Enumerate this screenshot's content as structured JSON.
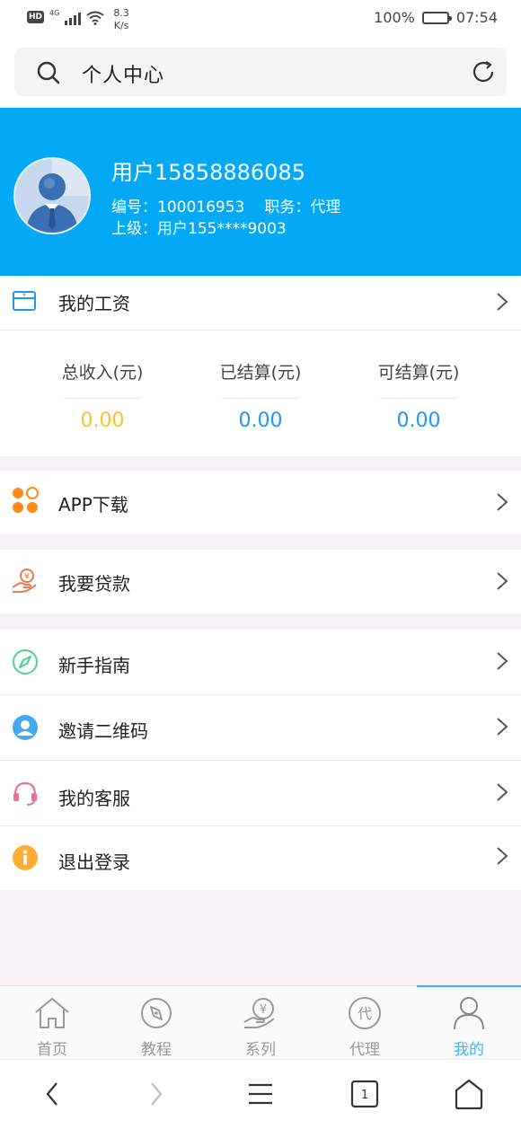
{
  "status_bar": {
    "hd": "HD",
    "network": "4G",
    "speed_value": "8.3",
    "speed_unit": "K/s",
    "battery": "100%",
    "time": "07:54"
  },
  "header": {
    "title": "个人中心",
    "search_icon": "search-icon",
    "refresh_icon": "refresh-icon"
  },
  "profile": {
    "name": "用户15858886085",
    "id_label": "编号：",
    "id_value": "100016953",
    "role_label": "职务：",
    "role_value": "代理",
    "parent_label": "上级：",
    "parent_value": "用户155****9003",
    "banner_color": "#03a9f4"
  },
  "salary": {
    "label": "我的工资",
    "stats": [
      {
        "label": "总收入(元)",
        "value": "0.00",
        "color": "#f7c12f"
      },
      {
        "label": "已结算(元)",
        "value": "0.00",
        "color": "#2196f3"
      },
      {
        "label": "可结算(元)",
        "value": "0.00",
        "color": "#2196f3"
      }
    ]
  },
  "menu": {
    "app_download": "APP下载",
    "loan": "我要贷款",
    "guide": "新手指南",
    "invite_qr": "邀请二维码",
    "customer_service": "我的客服",
    "logout": "退出登录"
  },
  "tabs": [
    {
      "label": "首页",
      "icon": "home-icon"
    },
    {
      "label": "教程",
      "icon": "compass-icon"
    },
    {
      "label": "系列",
      "icon": "yen-hand-icon"
    },
    {
      "label": "代理",
      "icon": "agent-icon",
      "glyph": "代"
    },
    {
      "label": "我的",
      "icon": "user-icon",
      "active": true
    }
  ],
  "system_nav": {
    "tabs_count": "1"
  }
}
